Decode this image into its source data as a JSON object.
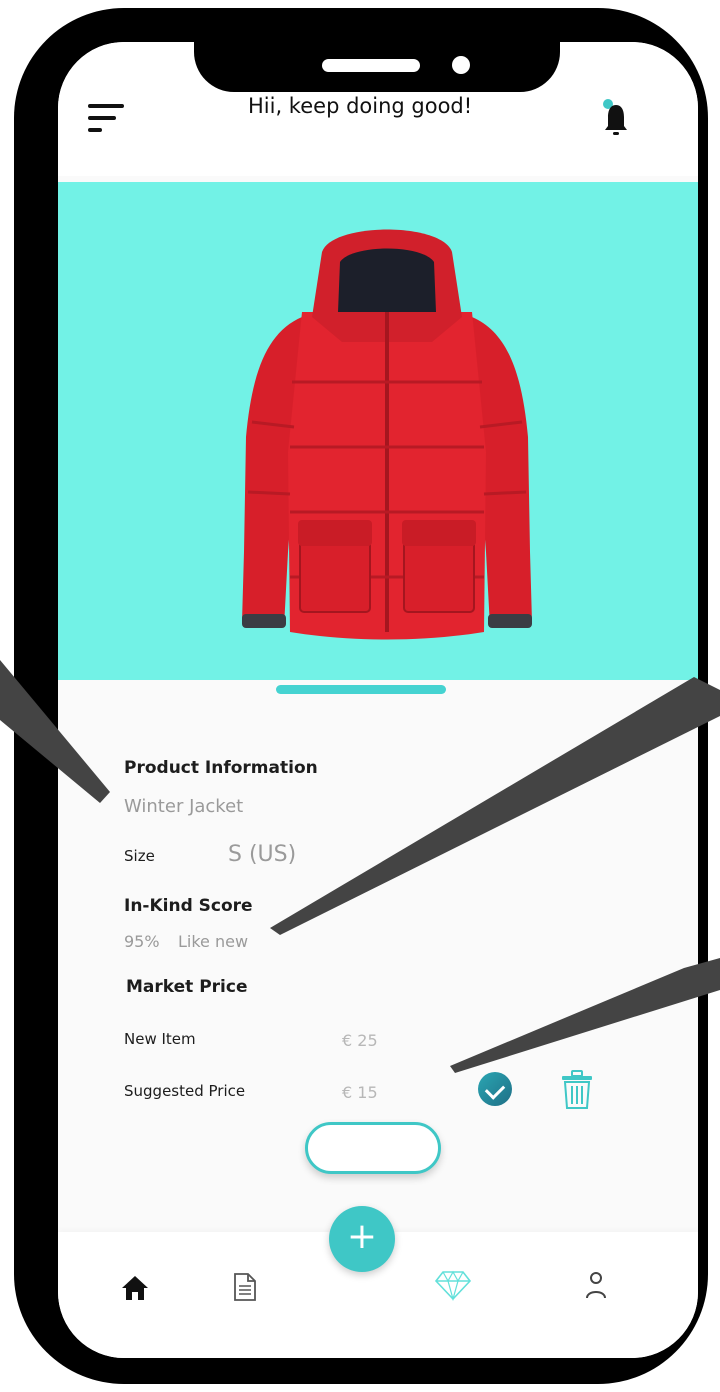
{
  "header": {
    "greeting": "Hii, keep doing good!"
  },
  "product": {
    "section_title": "Product Information",
    "name": "Winter Jacket",
    "size_label": "Size",
    "size_value": "S (US)",
    "score_title": "In-Kind Score",
    "score_percent": "95%",
    "score_condition": "Like new",
    "market_title": "Market Price",
    "new_item_label": "New Item",
    "new_item_price": "€ 25",
    "suggested_label": "Suggested Price",
    "suggested_price": "€ 15"
  },
  "colors": {
    "hero_bg": "#72f2e6",
    "accent": "#3fc7c6",
    "jacket": "#e2242f"
  },
  "icons": {
    "menu": "menu-icon",
    "bell": "bell-icon",
    "check": "check-icon",
    "trash": "trash-icon",
    "add": "plus-icon",
    "home": "home-icon",
    "document": "document-icon",
    "diamond": "diamond-icon",
    "profile": "profile-icon"
  },
  "fab_label": "+"
}
